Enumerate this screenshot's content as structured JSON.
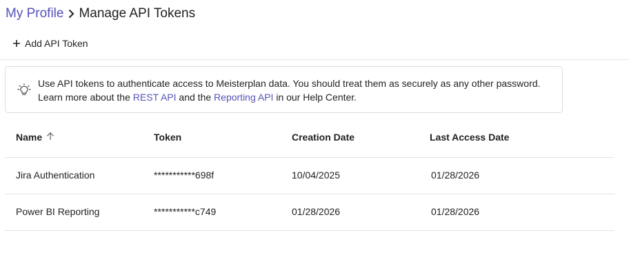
{
  "breadcrumb": {
    "parent": "My Profile",
    "separator_icon": "chevron-right-icon",
    "current": "Manage API Tokens"
  },
  "toolbar": {
    "add_label": "Add API Token",
    "add_icon": "plus-icon"
  },
  "info": {
    "icon": "lightbulb-icon",
    "line1": "Use API tokens to authenticate access to Meisterplan data. You should treat them as securely as any other password.",
    "line2_prefix": "Learn more about the ",
    "rest_api_link": "REST API",
    "line2_middle": " and the ",
    "reporting_api_link": "Reporting API",
    "line2_suffix": " in our Help Center."
  },
  "table": {
    "columns": [
      {
        "label": "Name",
        "sort_icon": "arrow-up-icon"
      },
      {
        "label": "Token"
      },
      {
        "label": "Creation Date"
      },
      {
        "label": "Last Access Date"
      }
    ],
    "rows": [
      {
        "name": "Jira Authentication",
        "token": "***********698f",
        "created": "10/04/2025",
        "last_access": "01/28/2026"
      },
      {
        "name": "Power BI Reporting",
        "token": "***********c749",
        "created": "01/28/2026",
        "last_access": "01/28/2026"
      }
    ]
  },
  "colors": {
    "link": "#5552b8",
    "text": "#212121",
    "border": "#e3e3e3"
  }
}
